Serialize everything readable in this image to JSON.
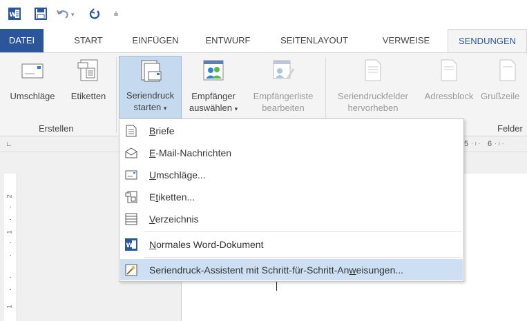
{
  "qat": {
    "app_icon": "word-icon",
    "save_icon": "save-icon",
    "undo_icon": "undo-icon",
    "redo_icon": "redo-icon",
    "customize_icon": "customize-qat-icon"
  },
  "tabs": [
    {
      "label": "DATEI"
    },
    {
      "label": "START"
    },
    {
      "label": "EINFÜGEN"
    },
    {
      "label": "ENTWURF"
    },
    {
      "label": "SEITENLAYOUT"
    },
    {
      "label": "VERWEISE"
    },
    {
      "label": "SENDUNGEN"
    }
  ],
  "ribbon": {
    "erstellen": {
      "label": "Erstellen",
      "umschlaege": "Umschläge",
      "etiketten": "Etiketten"
    },
    "seriendruck": {
      "start_line1": "Seriendruck",
      "start_line2": "starten",
      "empf_line1": "Empfänger",
      "empf_line2": "auswählen",
      "liste_line1": "Empfängerliste",
      "liste_line2": "bearbeiten"
    },
    "felder": {
      "label": "Felder",
      "hervor_line1": "Seriendruckfelder",
      "hervor_line2": "hervorheben",
      "adressblock": "Adressblock",
      "gruss": "Grußzeile"
    }
  },
  "ruler": {
    "h_numbers": [
      "5",
      "6"
    ],
    "v_numbers": [
      "2",
      "1",
      "1"
    ]
  },
  "menu": {
    "items": [
      {
        "pre": "",
        "ul": "B",
        "post": "riefe"
      },
      {
        "pre": "",
        "ul": "E",
        "post": "-Mail-Nachrichten"
      },
      {
        "pre": "",
        "ul": "U",
        "post": "mschläge..."
      },
      {
        "pre": "E",
        "ul": "t",
        "post": "iketten..."
      },
      {
        "pre": "",
        "ul": "V",
        "post": "erzeichnis"
      },
      {
        "pre": "",
        "ul": "N",
        "post": "ormales Word-Dokument"
      },
      {
        "pre": "Seriendruck-Assistent mit Schritt-für-Schritt-An",
        "ul": "w",
        "post": "eisungen..."
      }
    ]
  },
  "colors": {
    "word_blue": "#2b579a",
    "ribbon_bg": "#f4f4f4",
    "hover": "#cde0f3"
  }
}
